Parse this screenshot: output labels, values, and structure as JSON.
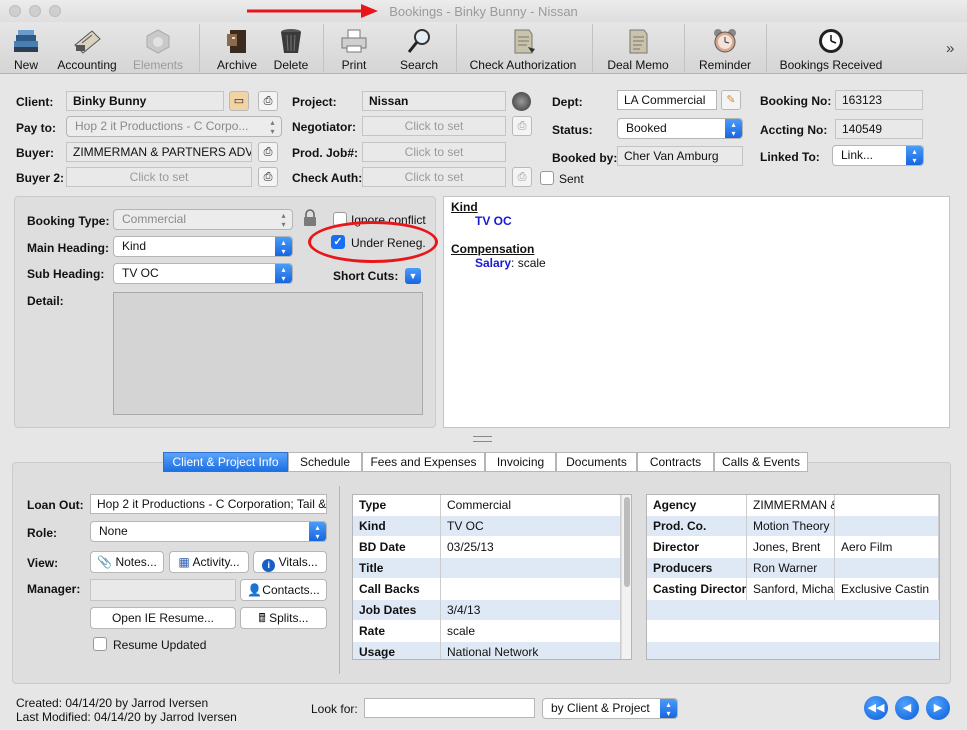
{
  "window": {
    "title": "Bookings - Binky Bunny - Nissan"
  },
  "toolbar": [
    {
      "label": "New",
      "icon": "books-icon"
    },
    {
      "label": "Accounting",
      "icon": "ledger-icon"
    },
    {
      "label": "Elements",
      "icon": "elements-icon",
      "disabled": true
    },
    {
      "label": "Archive",
      "icon": "archive-cabinet-icon"
    },
    {
      "label": "Delete",
      "icon": "trash-icon"
    },
    {
      "label": "Print",
      "icon": "printer-icon"
    },
    {
      "label": "Search",
      "icon": "magnifier-icon"
    },
    {
      "label": "Check Authorization",
      "icon": "document-icon"
    },
    {
      "label": "Deal Memo",
      "icon": "memo-icon"
    },
    {
      "label": "Reminder",
      "icon": "alarm-clock-icon"
    },
    {
      "label": "Bookings Received",
      "icon": "clock-icon"
    }
  ],
  "form": {
    "client_label": "Client:",
    "client": "Binky Bunny",
    "payto_label": "Pay to:",
    "payto": "Hop 2 it Productions - C Corpo...",
    "buyer_label": "Buyer:",
    "buyer": "ZIMMERMAN & PARTNERS ADV.",
    "buyer2_label": "Buyer 2:",
    "buyer2_placeholder": "Click to set",
    "project_label": "Project:",
    "project": "Nissan",
    "negotiator_label": "Negotiator:",
    "negotiator_placeholder": "Click to set",
    "prodjob_label": "Prod. Job#:",
    "prodjob_placeholder": "Click to set",
    "checkauth_label": "Check Auth:",
    "checkauth_placeholder": "Click to set",
    "dept_label": "Dept:",
    "dept": "LA Commercial",
    "status_label": "Status:",
    "status": "Booked",
    "bookedby_label": "Booked by:",
    "bookedby": "Cher Van Amburg",
    "sent_label": "Sent",
    "bookingno_label": "Booking No:",
    "bookingno": "163123",
    "acctingno_label": "Accting No:",
    "acctingno": "140549",
    "linkedto_label": "Linked To:",
    "linkedto": "Link..."
  },
  "booking": {
    "type_label": "Booking Type:",
    "type": "Commercial",
    "main_heading_label": "Main Heading:",
    "main_heading": "Kind",
    "sub_heading_label": "Sub Heading:",
    "sub_heading": "TV OC",
    "detail_label": "Detail:",
    "ignore_conflict_label": "Ignore conflict",
    "under_reneg_label": "Under Reneg.",
    "shortcuts_label": "Short Cuts:"
  },
  "summary": {
    "kind_heading": "Kind",
    "kind_value": "TV OC",
    "comp_heading": "Compensation",
    "salary_key": "Salary",
    "salary_value": ": scale"
  },
  "tabs": [
    "Client & Project Info",
    "Schedule",
    "Fees and Expenses",
    "Invoicing",
    "Documents",
    "Contracts",
    "Calls & Events"
  ],
  "client_info": {
    "loanout_label": "Loan Out:",
    "loanout": "Hop 2 it Productions - C Corporation; Tail &",
    "role_label": "Role:",
    "role": "None",
    "view_label": "View:",
    "notes_btn": "Notes...",
    "activity_btn": "Activity...",
    "vitals_btn": "Vitals...",
    "manager_label": "Manager:",
    "contacts_btn": "Contacts...",
    "open_resume_btn": "Open IE Resume...",
    "splits_btn": "Splits...",
    "resume_updated_label": "Resume Updated"
  },
  "details_table": [
    [
      "Type",
      "Commercial"
    ],
    [
      "Kind",
      "TV OC"
    ],
    [
      "BD Date",
      "03/25/13"
    ],
    [
      "Title",
      ""
    ],
    [
      "Call Backs",
      ""
    ],
    [
      "Job Dates",
      "3/4/13"
    ],
    [
      "Rate",
      "scale"
    ],
    [
      "Usage",
      "National Network"
    ]
  ],
  "agency_table": [
    [
      "Agency",
      "ZIMMERMAN &",
      ""
    ],
    [
      "Prod. Co.",
      "Motion Theory I",
      ""
    ],
    [
      "Director",
      "Jones, Brent",
      "Aero Film"
    ],
    [
      "Producers",
      "Ron Warner",
      ""
    ],
    [
      "Casting Director",
      "Sanford, Michae",
      "Exclusive Castin"
    ]
  ],
  "footer": {
    "created": "Created: 04/14/20 by Jarrod Iversen",
    "modified": "Last Modified: 04/14/20 by Jarrod Iversen",
    "lookfor_label": "Look for:",
    "search_mode": "by Client & Project"
  },
  "colors": {
    "accent": "#1a6ff0",
    "annotation": "#e8161b",
    "link_blue": "#1a1ad0"
  }
}
